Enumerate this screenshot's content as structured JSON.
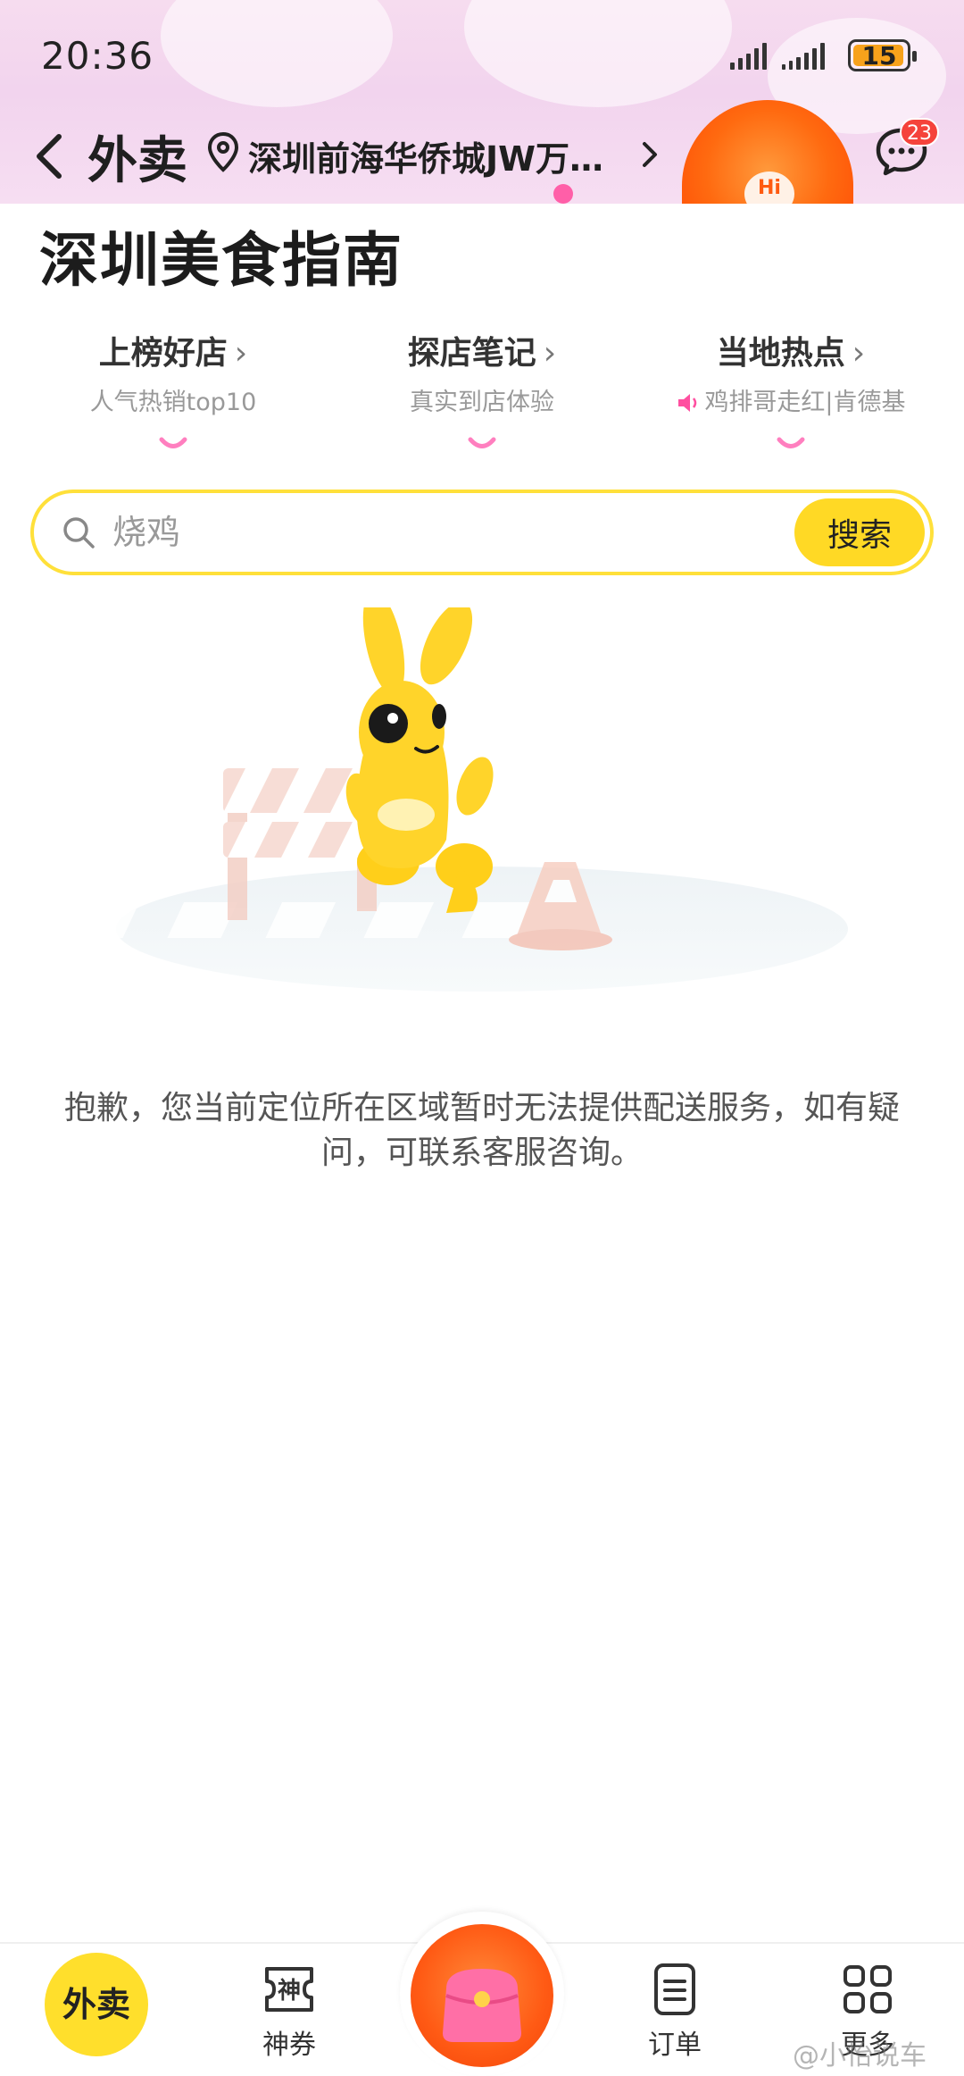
{
  "status_bar": {
    "time": "20:36",
    "battery": "15"
  },
  "nav": {
    "title": "外卖",
    "location": "深圳前海华侨城JW万…",
    "hi_label": "Hi",
    "message_count": "23"
  },
  "page": {
    "title": "深圳美食指南"
  },
  "guides": [
    {
      "title": "上榜好店",
      "subtitle": "人气热销top10"
    },
    {
      "title": "探店笔记",
      "subtitle": "真实到店体验"
    },
    {
      "title": "当地热点",
      "subtitle": "鸡排哥走红|肯德基"
    }
  ],
  "search": {
    "placeholder": "烧鸡",
    "button_label": "搜索"
  },
  "notice": "抱歉，您当前定位所在区域暂时无法提供配送服务，如有疑问，可联系客服咨询。",
  "tabbar": {
    "home_label": "外卖",
    "coupon_label": "神券",
    "coupon_icon_text": "神",
    "orders_label": "订单",
    "more_label": "更多"
  },
  "watermark": "@小怡说车",
  "colors": {
    "accent_yellow": "#ffd925",
    "search_border": "#ffe03a",
    "header_pink": "#f4d8ee",
    "badge_red": "#f5433b",
    "ball_orange": "#ff5a14"
  }
}
